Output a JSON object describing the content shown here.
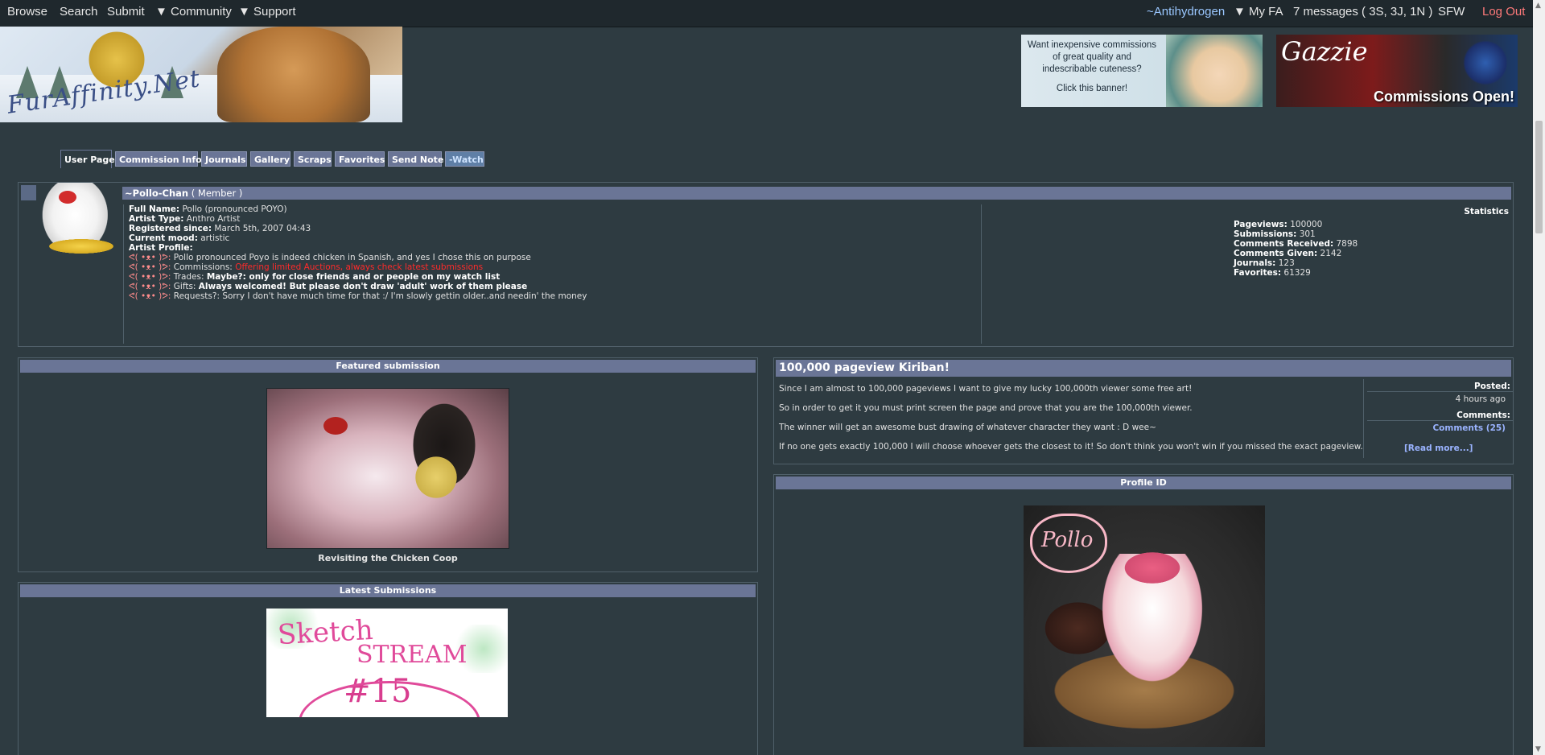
{
  "topnav": {
    "browse": "Browse",
    "search": "Search",
    "submit": "Submit",
    "community": "▼ Community",
    "support": "▼ Support",
    "username": "~Antihydrogen",
    "myfa": "▼ My FA",
    "messages": "7 messages ( 3S, 3J, 1N )",
    "sfw": "SFW",
    "logout": "Log Out"
  },
  "header": {
    "logo_text": "FurAffinity.Net",
    "ad1": {
      "line1": "Want inexpensive commissions",
      "line2": "of great quality and",
      "line3": "indescribable cuteness?",
      "line4": "Click this banner!"
    },
    "ad2": {
      "name": "Gazzie",
      "tagline": "Commissions Open!"
    }
  },
  "tabs": [
    "User Page",
    "Commission Info",
    "Journals",
    "Gallery",
    "Scraps",
    "Favorites",
    "Send Note",
    "-Watch"
  ],
  "profile": {
    "username": "~Pollo-Chan",
    "member_type": "( Member )",
    "fields": [
      {
        "label": "Full Name:",
        "value": "Pollo (pronounced POYO)"
      },
      {
        "label": "Artist Type:",
        "value": "Anthro Artist"
      },
      {
        "label": "Registered since:",
        "value": "March 5th, 2007 04:43"
      },
      {
        "label": "Current mood:",
        "value": "artistic"
      },
      {
        "label": "Artist Profile:",
        "value": ""
      }
    ],
    "bullet_prefix": "ᕙ( •ᴥ• )ᕗ:",
    "bullets": [
      {
        "text": "Pollo pronounced Poyo is indeed chicken in Spanish, and yes I chose this on purpose",
        "highlight": ""
      },
      {
        "text": "Commissions: ",
        "highlight": "Offering limited Auctions, always check latest submissions"
      },
      {
        "text": "Trades: ",
        "highlight": "Maybe?: only for close friends and or people on my watch list"
      },
      {
        "text": "Gifts: ",
        "highlight": "Always welcomed! But please don't draw 'adult' work of them please"
      },
      {
        "text": "Requests?: Sorry I don't have much time for that :/ I'm slowly gettin older..and needin' the money",
        "highlight": ""
      }
    ],
    "stats_title": "Statistics",
    "stats": [
      {
        "label": "Pageviews:",
        "value": "100000"
      },
      {
        "label": "Submissions:",
        "value": "301"
      },
      {
        "label": "Comments Received:",
        "value": "7898"
      },
      {
        "label": "Comments Given:",
        "value": "2142"
      },
      {
        "label": "Journals:",
        "value": "123"
      },
      {
        "label": "Favorites:",
        "value": "61329"
      }
    ]
  },
  "featured": {
    "heading": "Featured submission",
    "caption": "Revisiting the Chicken Coop"
  },
  "latest": {
    "heading": "Latest Submissions",
    "thumb_line1": "Sketch",
    "thumb_line2": "STREAM",
    "thumb_line3": "#15"
  },
  "journal": {
    "title": "100,000 pageview Kiriban!",
    "paragraphs": [
      "Since I am almost to 100,000 pageviews I want to give my lucky 100,000th viewer some free art!",
      "So in order to get it you must print screen the page and prove that you are the 100,000th viewer.",
      "The winner will get an awesome bust drawing of whatever character they want : D wee~",
      "If no one gets exactly 100,000 I will choose whoever gets the closest to it! So don't think you won't win if you missed the exact pageview."
    ],
    "posted_label": "Posted:",
    "posted_value": "4 hours ago",
    "comments_label": "Comments:",
    "comments_link": "Comments (25)",
    "read_more": "[Read more...]"
  },
  "profile_id": {
    "heading": "Profile ID",
    "heart_text": "Pollo"
  }
}
